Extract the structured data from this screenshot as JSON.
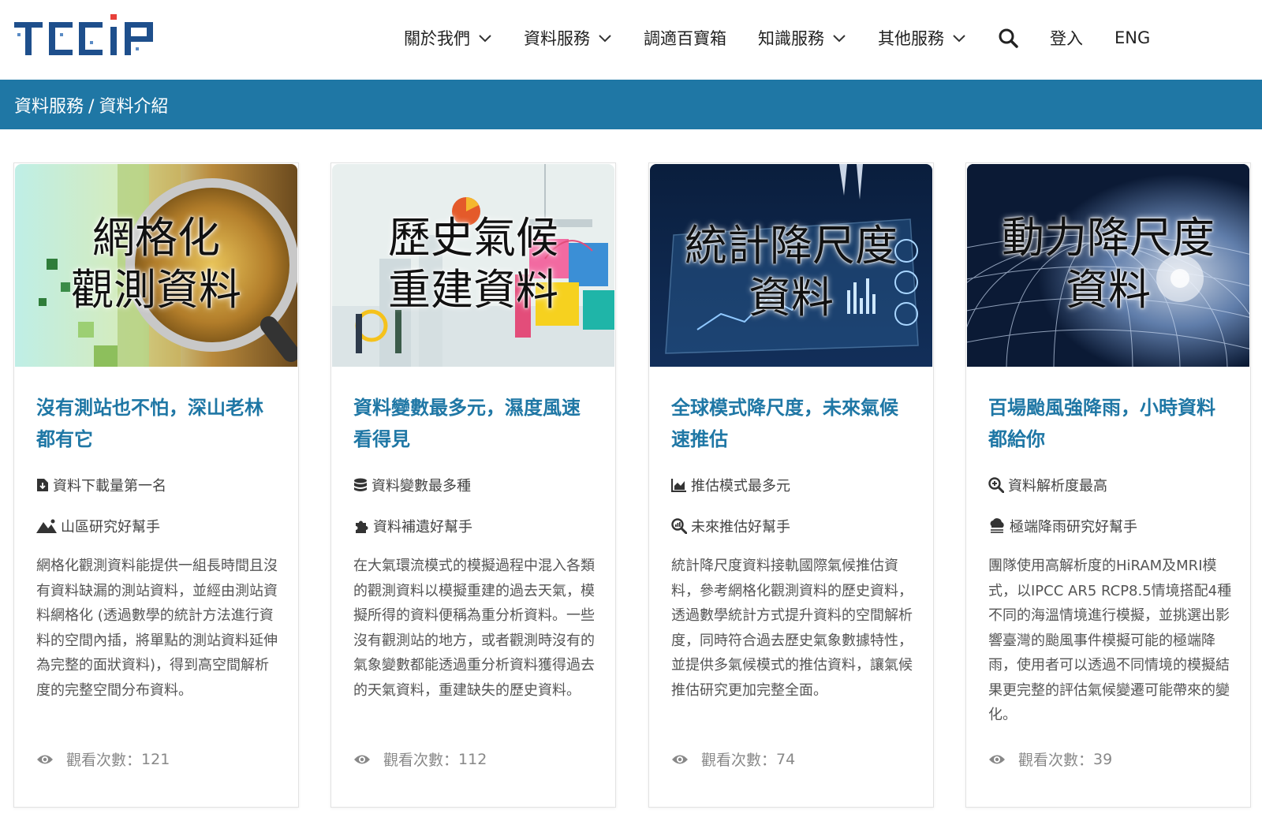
{
  "header": {
    "logo_text": "TCCIP",
    "nav": [
      {
        "label": "關於我們",
        "has_dropdown": true
      },
      {
        "label": "資料服務",
        "has_dropdown": true
      },
      {
        "label": "調適百寶箱",
        "has_dropdown": false
      },
      {
        "label": "知識服務",
        "has_dropdown": true
      },
      {
        "label": "其他服務",
        "has_dropdown": true
      }
    ],
    "search_icon": "search-icon",
    "login": "登入",
    "lang": "ENG"
  },
  "breadcrumb": {
    "parent": "資料服務",
    "separator": "/",
    "current": "資料介紹"
  },
  "cards": [
    {
      "image_title": [
        "網格化",
        "觀測資料"
      ],
      "title": "沒有測站也不怕，深山老林都有它",
      "features": [
        {
          "icon": "file-download-icon",
          "text": "資料下載量第一名"
        },
        {
          "icon": "mountain-icon",
          "text": "山區研究好幫手"
        }
      ],
      "description": "網格化觀測資料能提供一組長時間且沒有資料缺漏的測站資料，並經由測站資 料網格化 (透過數學的統計方法進行資料的空間內插，將單點的測站資料延伸 為完整的面狀資料)，得到高空間解析度的完整空間分布資料。",
      "views_label": "觀看次數：",
      "views": "121"
    },
    {
      "image_title": [
        "歷史氣候",
        "重建資料"
      ],
      "title": "資料變數最多元，濕度風速看得見",
      "features": [
        {
          "icon": "database-icon",
          "text": "資料變數最多種"
        },
        {
          "icon": "puzzle-icon",
          "text": "資料補遺好幫手"
        }
      ],
      "description": "在大氣環流模式的模擬過程中混入各類的觀測資料以模擬重建的過去天氣，模擬所得的資料便稱為重分析資料。一些沒有觀測站的地方，或者觀測時沒有的氣象變數都能透過重分析資料獲得過去的天氣資料，重建缺失的歷史資料。",
      "views_label": "觀看次數：",
      "views": "112"
    },
    {
      "image_title": [
        "統計降尺度",
        "資料"
      ],
      "title": "全球模式降尺度，未來氣候速推估",
      "features": [
        {
          "icon": "area-chart-icon",
          "text": "推估模式最多元"
        },
        {
          "icon": "search-chart-icon",
          "text": "未來推估好幫手"
        }
      ],
      "description": "統計降尺度資料接軌國際氣候推估資料，參考網格化觀測資料的歷史資料，透過數學統計方式提升資料的空間解析度，同時符合過去歷史氣象數據特性，並提供多氣候模式的推估資料，讓氣候推估研究更加完整全面。",
      "views_label": "觀看次數：",
      "views": "74"
    },
    {
      "image_title": [
        "動力降尺度",
        "資料"
      ],
      "title": "百場颱風強降雨，小時資料都給你",
      "features": [
        {
          "icon": "search-plus-icon",
          "text": "資料解析度最高"
        },
        {
          "icon": "rain-cloud-icon",
          "text": "極端降雨研究好幫手"
        }
      ],
      "description": "團隊使用高解析度的HiRAM及MRI模式，以IPCC AR5 RCP8.5情境搭配4種不同的海溫情境進行模擬，並挑選出影響臺灣的颱風事件模擬可能的極端降雨，使用者可以透過不同情境的模擬結果更完整的評估氣候變遷可能帶來的變化。",
      "views_label": "觀看次數：",
      "views": "39"
    }
  ],
  "colors": {
    "brand_blue": "#1f77a5",
    "logo_dark": "#1e4f8c",
    "logo_accent": "#e8403a"
  }
}
